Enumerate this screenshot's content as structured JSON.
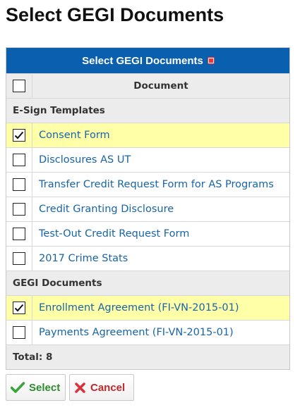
{
  "page": {
    "title": "Select GEGI Documents"
  },
  "grid": {
    "header": "Select GEGI Documents",
    "column_header": "Document",
    "groups": [
      {
        "label": "E-Sign Templates",
        "items": [
          {
            "label": "Consent Form",
            "checked": true
          },
          {
            "label": "Disclosures AS UT",
            "checked": false
          },
          {
            "label": "Transfer Credit Request Form for AS Programs",
            "checked": false
          },
          {
            "label": "Credit Granting Disclosure",
            "checked": false
          },
          {
            "label": "Test-Out Credit Request Form",
            "checked": false
          },
          {
            "label": "2017 Crime Stats",
            "checked": false
          }
        ]
      },
      {
        "label": "GEGI Documents",
        "items": [
          {
            "label": "Enrollment Agreement (FI-VN-2015-01)",
            "checked": true
          },
          {
            "label": "Payments Agreement (FI-VN-2015-01)",
            "checked": false
          }
        ]
      }
    ],
    "total": "Total: 8"
  },
  "buttons": {
    "select": "Select",
    "cancel": "Cancel"
  },
  "colors": {
    "header_bg": "#0a5faf",
    "selected_row_bg": "#ffffa8",
    "link": "#1764a8",
    "select_green": "#2e8b2e",
    "cancel_red": "#c0282e"
  }
}
